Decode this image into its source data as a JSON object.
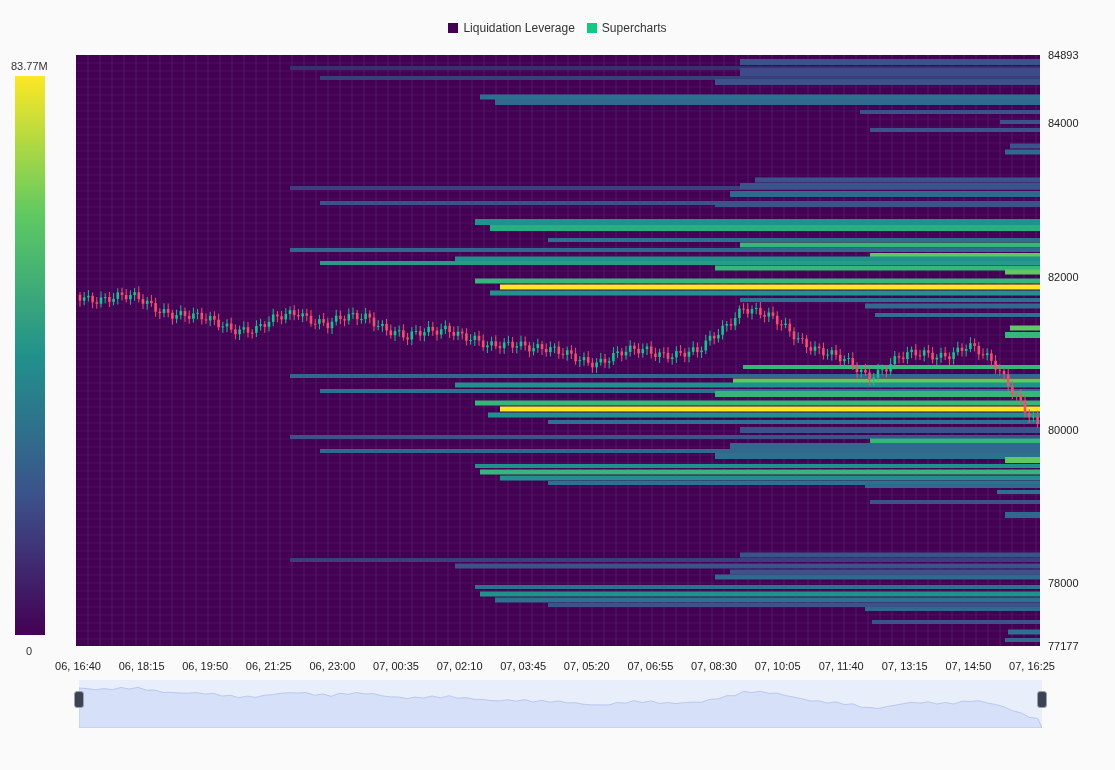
{
  "legend": [
    {
      "label": "Liquidation Leverage",
      "color": "#440154"
    },
    {
      "label": "Supercharts",
      "color": "#10c983"
    }
  ],
  "color_scale": {
    "max_label": "83.77M",
    "min_label": "0"
  },
  "y_axis_labels": [
    "84893",
    "84000",
    "82000",
    "80000",
    "78000",
    "77177"
  ],
  "x_axis_labels": [
    "06, 16:40",
    "06, 18:15",
    "06, 19:50",
    "06, 21:25",
    "06, 23:00",
    "07, 00:35",
    "07, 02:10",
    "07, 03:45",
    "07, 05:20",
    "07, 06:55",
    "07, 08:30",
    "07, 10:05",
    "07, 11:40",
    "07, 13:15",
    "07, 14:50",
    "07, 16:25"
  ]
}
